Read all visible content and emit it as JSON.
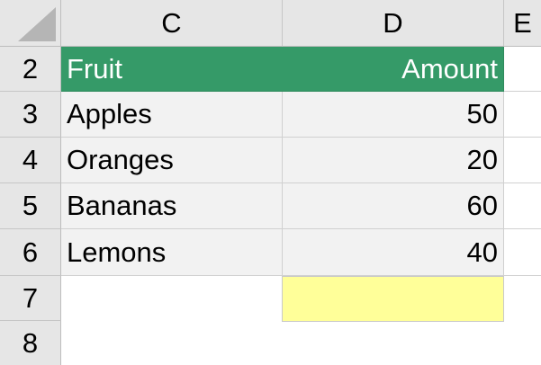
{
  "columns": [
    "C",
    "D",
    "E"
  ],
  "rows": [
    "2",
    "3",
    "4",
    "5",
    "6",
    "7",
    "8"
  ],
  "table": {
    "header": {
      "fruit": "Fruit",
      "amount": "Amount"
    },
    "items": [
      {
        "fruit": "Apples",
        "amount": "50"
      },
      {
        "fruit": "Oranges",
        "amount": "20"
      },
      {
        "fruit": "Bananas",
        "amount": "60"
      },
      {
        "fruit": "Lemons",
        "amount": "40"
      }
    ]
  },
  "colors": {
    "header_fill": "#359a68",
    "header_text": "#ffffff",
    "band_fill": "#f2f2f2",
    "highlight_fill": "#ffff99"
  }
}
